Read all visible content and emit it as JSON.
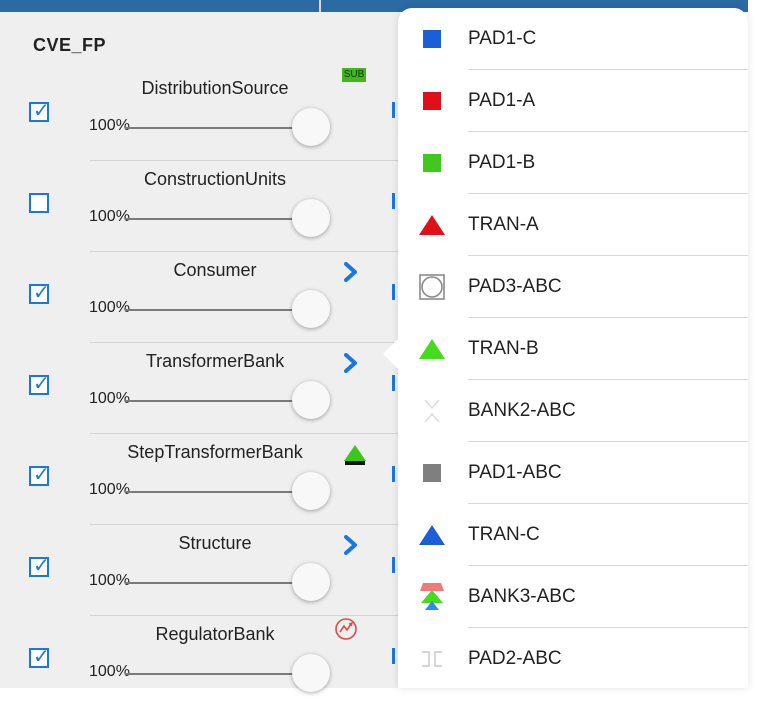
{
  "panel": {
    "title": "CVE_FP",
    "layers": [
      {
        "name": "DistributionSource",
        "checked": true,
        "opacity": "100%",
        "indicator": "sub-badge",
        "badge_text": "SUB"
      },
      {
        "name": "ConstructionUnits",
        "checked": false,
        "opacity": "100%",
        "indicator": "none"
      },
      {
        "name": "Consumer",
        "checked": true,
        "opacity": "100%",
        "indicator": "chevron-right-icon"
      },
      {
        "name": "TransformerBank",
        "checked": true,
        "opacity": "100%",
        "indicator": "chevron-right-icon"
      },
      {
        "name": "StepTransformerBank",
        "checked": true,
        "opacity": "100%",
        "indicator": "step-transformer-icon"
      },
      {
        "name": "Structure",
        "checked": true,
        "opacity": "100%",
        "indicator": "chevron-right-icon"
      },
      {
        "name": "RegulatorBank",
        "checked": true,
        "opacity": "100%",
        "indicator": "regulator-icon"
      }
    ]
  },
  "legend": {
    "items": [
      {
        "label": "PAD1-C",
        "symbol": "square",
        "color": "#1a5fd6"
      },
      {
        "label": "PAD1-A",
        "symbol": "square",
        "color": "#e0101a"
      },
      {
        "label": "PAD1-B",
        "symbol": "square",
        "color": "#40c81c"
      },
      {
        "label": "TRAN-A",
        "symbol": "triangle",
        "color": "#e0101a"
      },
      {
        "label": "PAD3-ABC",
        "symbol": "circle-in-square",
        "color": "#8a8a8a"
      },
      {
        "label": "TRAN-B",
        "symbol": "triangle",
        "color": "#44dd1e"
      },
      {
        "label": "BANK2-ABC",
        "symbol": "chevrons",
        "color": "#dcdcdc"
      },
      {
        "label": "PAD1-ABC",
        "symbol": "square",
        "color": "#7f7f7f"
      },
      {
        "label": "TRAN-C",
        "symbol": "triangle",
        "color": "#1a5fd6"
      },
      {
        "label": "BANK3-ABC",
        "symbol": "stacked-triangles",
        "color": "#44dd1e"
      },
      {
        "label": "PAD2-ABC",
        "symbol": "brackets",
        "color": "#c8c8c8"
      }
    ]
  },
  "colors": {
    "accent": "#1878e0",
    "topbar": "#2c6aa3",
    "sub_badge": "#43b520"
  }
}
